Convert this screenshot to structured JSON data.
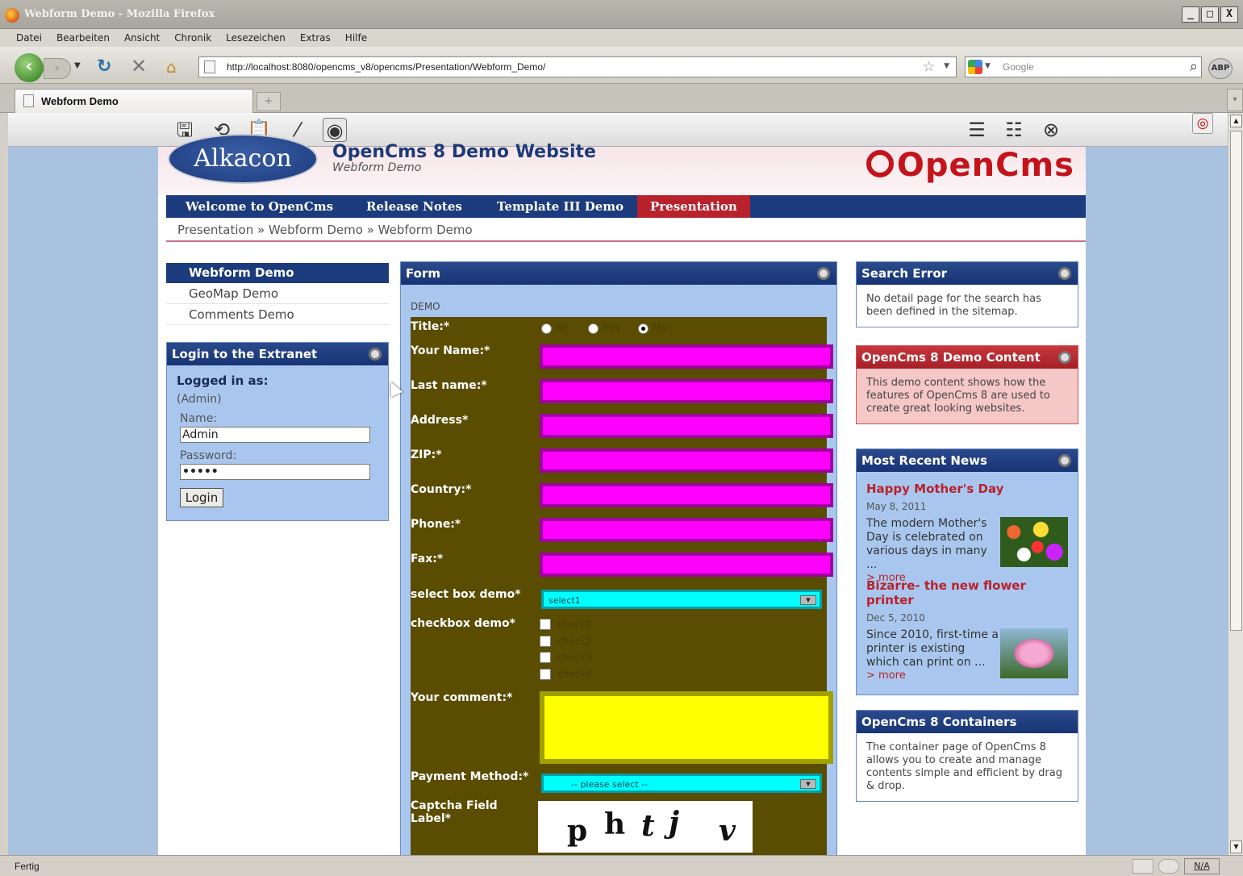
{
  "window": {
    "title": "Webform Demo - Mozilla Firefox",
    "controls": [
      "_",
      "□",
      "X"
    ]
  },
  "menu": [
    "Datei",
    "Bearbeiten",
    "Ansicht",
    "Chronik",
    "Lesezeichen",
    "Extras",
    "Hilfe"
  ],
  "navbar": {
    "url": "http://localhost:8080/opencms_v8/opencms/Presentation/Webform_Demo/",
    "search_placeholder": "Google",
    "abp_label": "ABP"
  },
  "tab": {
    "label": "Webform Demo"
  },
  "site": {
    "logo_text": "Alkacon",
    "title": "OpenCms 8 Demo Website",
    "subtitle": "Webform Demo",
    "brand": "OpenCms"
  },
  "mainnav": [
    {
      "label": "Welcome to OpenCms"
    },
    {
      "label": "Release Notes"
    },
    {
      "label": "Template III Demo"
    },
    {
      "label": "Presentation"
    }
  ],
  "breadcrumb": "Presentation  »  Webform Demo  »  Webform Demo",
  "leftnav": {
    "header": "Webform Demo",
    "links": [
      "GeoMap Demo",
      "Comments Demo"
    ]
  },
  "login": {
    "title": "Login to the Extranet",
    "logged_in_label": "Logged in as:",
    "logged_in_user": "(Admin)",
    "name_label": "Name:",
    "name_value": "Admin",
    "password_label": "Password:",
    "password_value": "•••••",
    "button": "Login"
  },
  "form": {
    "title": "Form",
    "section": "DEMO",
    "title_label": "Title:*",
    "title_options": [
      "Mr",
      "Mrs",
      "Ms"
    ],
    "fields": [
      {
        "label": "Your Name:*"
      },
      {
        "label": "Last name:*"
      },
      {
        "label": "Address*"
      },
      {
        "label": "ZIP:*"
      },
      {
        "label": "Country:*"
      },
      {
        "label": "Phone:*"
      },
      {
        "label": "Fax:*"
      }
    ],
    "select_label": "select box demo*",
    "select_value": "select1",
    "checkbox_label": "checkbox demo*",
    "checkbox_options": [
      "check1",
      "check2",
      "check3",
      "check4"
    ],
    "comment_label": "Your comment:*",
    "payment_label": "Payment Method:*",
    "payment_value": "-- please select --",
    "captcha_label": "Captcha Field Label*",
    "captcha_chars": [
      "p",
      "h",
      "t",
      "j",
      "v"
    ]
  },
  "sidebar": {
    "search_error": {
      "title": "Search Error",
      "text": "No detail page for the search has been defined in the sitemap."
    },
    "demo_content": {
      "title": "OpenCms 8 Demo Content",
      "text": "This demo content shows how the features of OpenCms 8 are used to create great looking websites."
    },
    "recent_news": {
      "title": "Most Recent News",
      "items": [
        {
          "title": "Happy Mother's Day",
          "date": "May 8, 2011",
          "text": "The modern Mother's Day is celebrated on various days in many ...",
          "more": "> more"
        },
        {
          "title": "Bizarre- the new flower printer",
          "date": "Dec 5, 2010",
          "text": "Since 2010, first-time a printer is existing which can print on ...",
          "more": "> more"
        }
      ]
    },
    "containers": {
      "title": "OpenCms 8 Containers",
      "text": "The container page of OpenCms 8 allows you to create and manage contents simple and efficient by drag & drop."
    }
  },
  "status": {
    "text": "Fertig",
    "na": "N/A"
  }
}
